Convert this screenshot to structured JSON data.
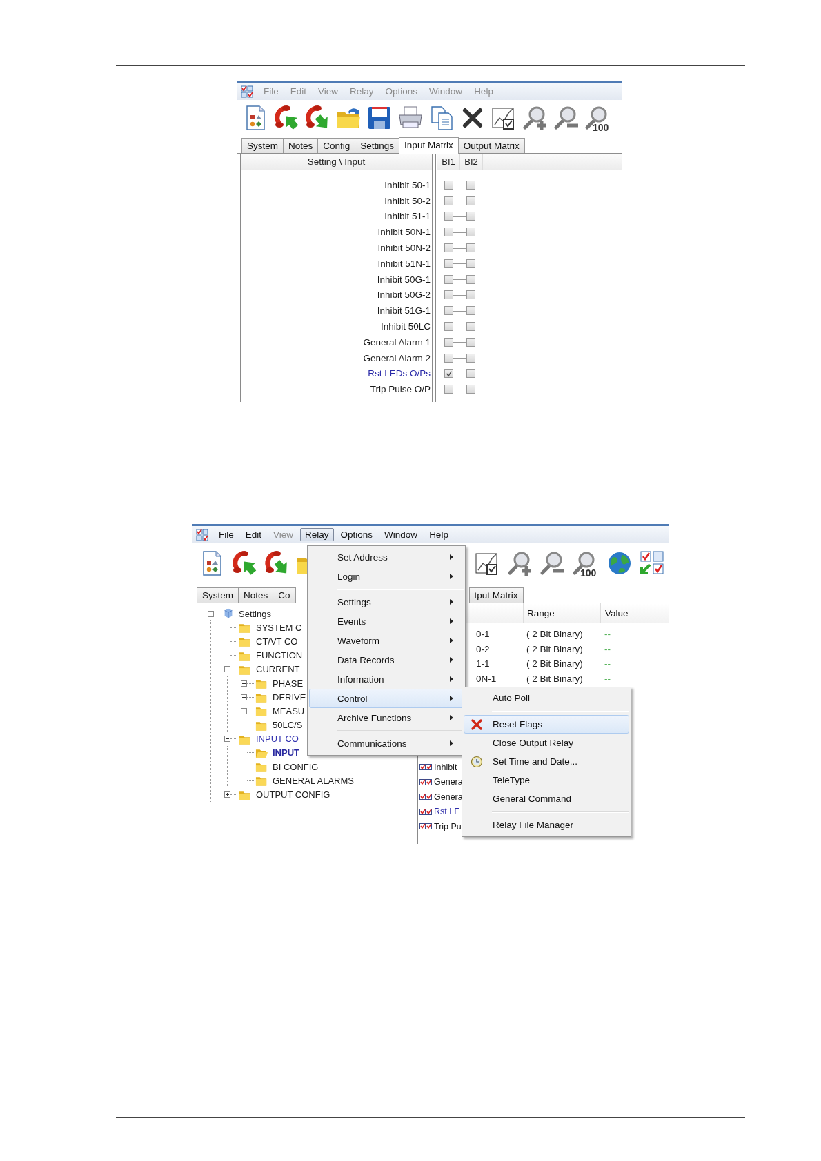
{
  "input_matrix_window": {
    "menubar": [
      {
        "label": "File",
        "disabled": true,
        "selected": false
      },
      {
        "label": "Edit",
        "disabled": true,
        "selected": false
      },
      {
        "label": "View",
        "disabled": true,
        "selected": false
      },
      {
        "label": "Relay",
        "disabled": true,
        "selected": false
      },
      {
        "label": "Options",
        "disabled": true,
        "selected": false
      },
      {
        "label": "Window",
        "disabled": true,
        "selected": false
      },
      {
        "label": "Help",
        "disabled": true,
        "selected": false
      }
    ],
    "toolbar": [
      [
        {
          "kind": "settings-file"
        },
        {
          "kind": "phone-up"
        },
        {
          "kind": "phone-down"
        },
        {
          "kind": "folder"
        },
        {
          "kind": "save"
        },
        {
          "kind": "printer"
        },
        {
          "kind": "copy"
        },
        {
          "kind": "delete"
        },
        {
          "kind": "chart"
        },
        {
          "kind": "zoom-in"
        },
        {
          "kind": "zoom-out"
        },
        {
          "kind": "zoom-100",
          "label": "100"
        }
      ]
    ],
    "tabs": [
      [
        {
          "label": "System",
          "selected": false
        },
        {
          "label": "Notes",
          "selected": false
        },
        {
          "label": "Config",
          "selected": false
        },
        {
          "label": "Settings",
          "selected": false
        },
        {
          "label": "Input Matrix",
          "selected": true
        },
        {
          "label": "Output Matrix",
          "selected": false
        }
      ]
    ],
    "matrix": {
      "header": "Setting \\ Input",
      "columns": [
        "BI1",
        "BI2"
      ],
      "rows": [
        {
          "label": "Inhibit 50-1",
          "color": "#1a1a1a",
          "checks": [
            false,
            false
          ]
        },
        {
          "label": "Inhibit 50-2",
          "color": "#1a1a1a",
          "checks": [
            false,
            false
          ]
        },
        {
          "label": "Inhibit 51-1",
          "color": "#1a1a1a",
          "checks": [
            false,
            false
          ]
        },
        {
          "label": "Inhibit 50N-1",
          "color": "#1a1a1a",
          "checks": [
            false,
            false
          ]
        },
        {
          "label": "Inhibit 50N-2",
          "color": "#1a1a1a",
          "checks": [
            false,
            false
          ]
        },
        {
          "label": "Inhibit 51N-1",
          "color": "#1a1a1a",
          "checks": [
            false,
            false
          ]
        },
        {
          "label": "Inhibit 50G-1",
          "color": "#1a1a1a",
          "checks": [
            false,
            false
          ]
        },
        {
          "label": "Inhibit 50G-2",
          "color": "#1a1a1a",
          "checks": [
            false,
            false
          ]
        },
        {
          "label": "Inhibit 51G-1",
          "color": "#1a1a1a",
          "checks": [
            false,
            false
          ]
        },
        {
          "label": "Inhibit 50LC",
          "color": "#1a1a1a",
          "checks": [
            false,
            false
          ]
        },
        {
          "label": "General Alarm 1",
          "color": "#1a1a1a",
          "checks": [
            false,
            false
          ]
        },
        {
          "label": "General Alarm 2",
          "color": "#1a1a1a",
          "checks": [
            false,
            false
          ]
        },
        {
          "label": "Rst LEDs O/Ps",
          "color": "#2b2ba8",
          "checks": [
            true,
            false
          ]
        },
        {
          "label": "Trip Pulse O/P",
          "color": "#1a1a1a",
          "checks": [
            false,
            false
          ]
        }
      ]
    }
  },
  "settings_window": {
    "menubar": [
      {
        "label": "File",
        "disabled": false,
        "selected": false
      },
      {
        "label": "Edit",
        "disabled": false,
        "selected": false
      },
      {
        "label": "View",
        "disabled": true,
        "selected": false
      },
      {
        "label": "Relay",
        "disabled": false,
        "selected": true
      },
      {
        "label": "Options",
        "disabled": false,
        "selected": false
      },
      {
        "label": "Window",
        "disabled": false,
        "selected": false
      },
      {
        "label": "Help",
        "disabled": false,
        "selected": false
      }
    ],
    "toolbar": [
      [
        {
          "kind": "settings-file"
        },
        {
          "kind": "phone-up"
        },
        {
          "kind": "phone-down"
        },
        {
          "kind": "folder"
        }
      ],
      [
        {
          "kind": "chart"
        },
        {
          "kind": "zoom-in"
        },
        {
          "kind": "zoom-out"
        },
        {
          "kind": "zoom-100",
          "label": "100"
        },
        {
          "kind": "globe"
        },
        {
          "kind": "matrix"
        }
      ]
    ],
    "tabs": [
      [
        {
          "label": "System",
          "selected": false
        },
        {
          "label": "Notes",
          "selected": false
        },
        {
          "label": "Co",
          "selected": false
        }
      ],
      [
        {
          "label": "tput Matrix",
          "selected": false
        }
      ]
    ],
    "tree": {
      "label": "Settings",
      "kind": "root",
      "selected": false,
      "expanded": true,
      "children": [
        {
          "label": "SYSTEM C",
          "kind": "folder",
          "selected": false
        },
        {
          "label": "CT/VT CO",
          "kind": "folder",
          "selected": false
        },
        {
          "label": "FUNCTION",
          "kind": "folder",
          "selected": false
        },
        {
          "label": "CURRENT",
          "kind": "folder",
          "selected": false,
          "expanded": true,
          "children": [
            {
              "label": "PHASE",
              "kind": "folder",
              "selected": false,
              "expanded": false
            },
            {
              "label": "DERIVE",
              "kind": "folder",
              "selected": false,
              "expanded": false
            },
            {
              "label": "MEASU",
              "kind": "folder",
              "selected": false,
              "expanded": false
            },
            {
              "label": "50LC/S",
              "kind": "folder",
              "selected": false
            }
          ]
        },
        {
          "label": "INPUT CO",
          "kind": "folder",
          "selected": false,
          "expanded": true,
          "children": [
            {
              "label": "INPUT",
              "kind": "folder",
              "selected": true
            },
            {
              "label": "BI CONFIG",
              "kind": "folder",
              "selected": false
            },
            {
              "label": "GENERAL ALARMS",
              "kind": "folder",
              "selected": false
            }
          ]
        },
        {
          "label": "OUTPUT CONFIG",
          "kind": "folder",
          "selected": false,
          "expanded": false
        }
      ]
    },
    "list": {
      "columns": [
        "Range",
        "Value"
      ],
      "top_rows": [
        {
          "name": "0-1",
          "range": "( 2 Bit Binary)",
          "value": "--"
        },
        {
          "name": "0-2",
          "range": "( 2 Bit Binary)",
          "value": "--"
        },
        {
          "name": "1-1",
          "range": "( 2 Bit Binary)",
          "value": "--"
        },
        {
          "name": "0N-1",
          "range": "( 2 Bit Binary)",
          "value": "--"
        }
      ],
      "bottom_rows": [
        {
          "name": "Inhibit",
          "color": "#1a1a1a"
        },
        {
          "name": "Genera",
          "color": "#1a1a1a"
        },
        {
          "name": "Genera",
          "color": "#1a1a1a"
        },
        {
          "name": "Rst LE",
          "color": "#2b2ba8"
        },
        {
          "name": "Trip Pu",
          "color": "#1a1a1a"
        }
      ]
    },
    "relay_menu": [
      {
        "kind": "item",
        "label": "Set Address",
        "submenu": true,
        "selected": false
      },
      {
        "kind": "item",
        "label": "Login",
        "submenu": true,
        "selected": false
      },
      {
        "kind": "separator"
      },
      {
        "kind": "item",
        "label": "Settings",
        "submenu": true,
        "selected": false
      },
      {
        "kind": "item",
        "label": "Events",
        "submenu": true,
        "selected": false
      },
      {
        "kind": "item",
        "label": "Waveform",
        "submenu": true,
        "selected": false
      },
      {
        "kind": "item",
        "label": "Data Records",
        "submenu": true,
        "selected": false
      },
      {
        "kind": "item",
        "label": "Information",
        "submenu": true,
        "selected": false
      },
      {
        "kind": "item",
        "label": "Control",
        "submenu": true,
        "selected": true
      },
      {
        "kind": "item",
        "label": "Archive Functions",
        "submenu": true,
        "selected": false
      },
      {
        "kind": "separator"
      },
      {
        "kind": "item",
        "label": "Communications",
        "submenu": true,
        "selected": false
      }
    ],
    "control_menu": [
      {
        "kind": "item",
        "label": "Auto Poll",
        "submenu": false,
        "selected": false
      },
      {
        "kind": "separator"
      },
      {
        "kind": "cross-item",
        "label": "Reset Flags",
        "submenu": false,
        "selected": true
      },
      {
        "kind": "item",
        "label": "Close Output Relay",
        "submenu": false,
        "selected": false
      },
      {
        "kind": "clock-item",
        "label": "Set Time and Date...",
        "submenu": false,
        "selected": false
      },
      {
        "kind": "item",
        "label": "TeleType",
        "submenu": false,
        "selected": false
      },
      {
        "kind": "item",
        "label": "General Command",
        "submenu": false,
        "selected": false
      },
      {
        "kind": "separator"
      },
      {
        "kind": "item",
        "label": "Relay File Manager",
        "submenu": false,
        "selected": false
      }
    ]
  }
}
